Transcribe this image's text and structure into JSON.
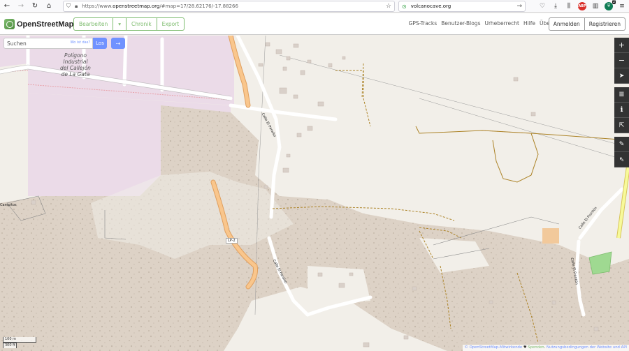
{
  "browser": {
    "url_prefix": "https://www.",
    "url_domain": "openstreetmap.org",
    "url_rest": "/#map=17/28.62176/-17.88266",
    "search_value": "volcanocave.org",
    "badge_count": "2"
  },
  "header": {
    "logo_text": "OpenStreetMap",
    "edit_label": "Bearbeiten",
    "edit_dropdown": "▾",
    "history_label": "Chronik",
    "export_label": "Export",
    "nav": [
      "GPS-Tracks",
      "Benutzer-Blogs",
      "Urheberrecht",
      "Hilfe",
      "Über"
    ],
    "login_label": "Anmelden",
    "register_label": "Registrieren"
  },
  "map": {
    "search_placeholder": "Suchen",
    "where_label": "Wo ist das?",
    "go_label": "Los",
    "labels": {
      "industrial": "Polígono\nIndustrial\ndel Callejón\nde La Gata",
      "campitos": "Campitos",
      "road_lp2": "LP-2",
      "calle_paraiso_1": "Calle El Paraíso",
      "calle_paraiso_2": "Calle El Paraíso",
      "calle_fronton_1": "Calle El Frontón",
      "calle_fronton_2": "Calle El Frontón"
    },
    "scale": {
      "metric": "100 m",
      "imperial": "300 ft"
    },
    "attribution": {
      "osm": "© OpenStreetMap-Mitwirkende",
      "heart": "♥",
      "donate": "Spenden",
      "terms": "Nutzungsbedingungen der Website und API"
    }
  }
}
